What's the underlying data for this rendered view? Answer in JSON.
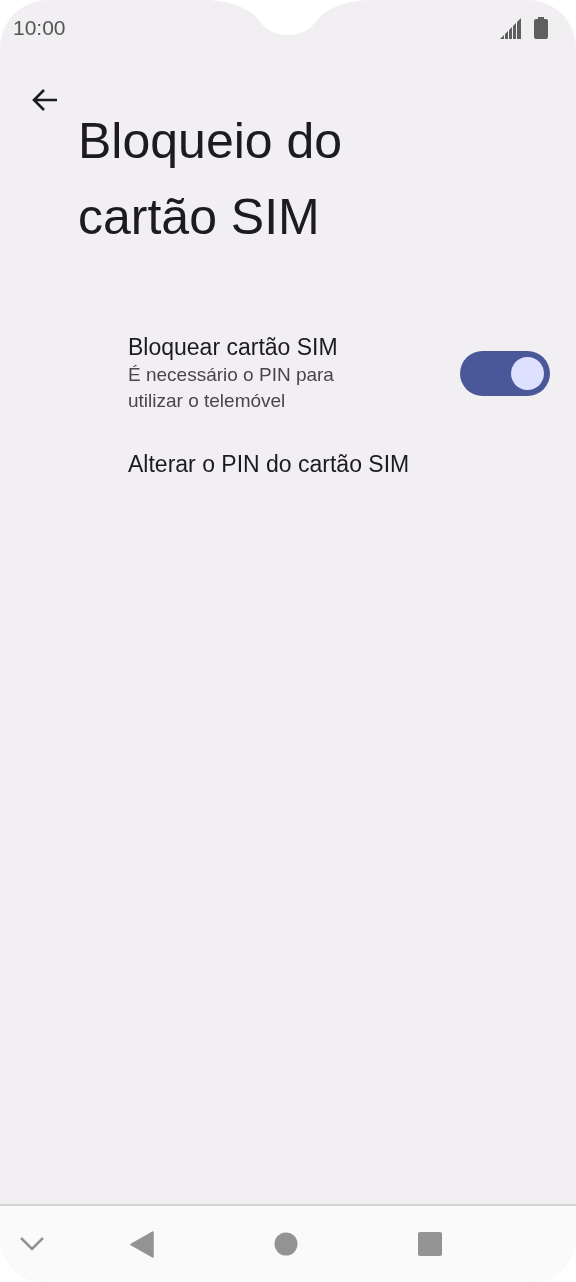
{
  "status_bar": {
    "time": "10:00"
  },
  "title": "Bloqueio do cartão SIM",
  "settings": [
    {
      "kind": "switch",
      "title": "Bloquear cartão SIM",
      "subtitle": "É necessário o PIN para utilizar o telemóvel",
      "on": true
    },
    {
      "kind": "plain",
      "title": "Alterar o PIN do cartão SIM"
    }
  ]
}
